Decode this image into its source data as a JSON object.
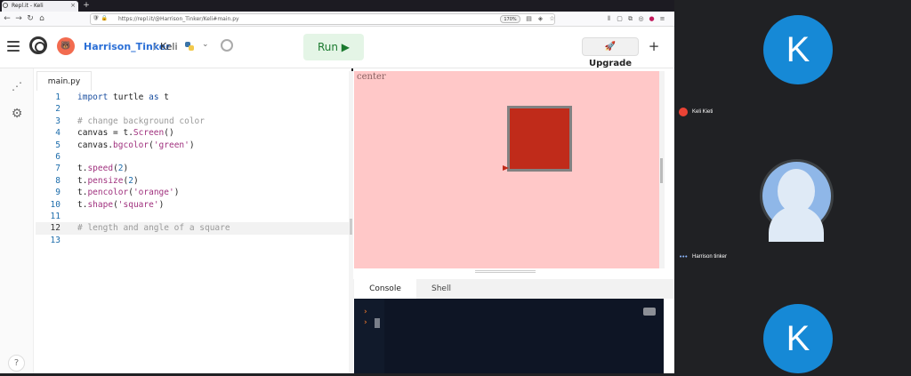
{
  "browser": {
    "tab_title": "Repl.it - Keli",
    "tab_close": "×",
    "new_tab": "+",
    "back": "←",
    "forward": "→",
    "reload": "↻",
    "home": "⌂",
    "url": "https://repl.it/@Harrison_Tinker/Keli#main.py",
    "zoom": "170%"
  },
  "header": {
    "avatar_initial": "🐻",
    "username": "Harrison_Tinker",
    "separator": "/",
    "repl_name": "Keli",
    "dropdown": "⌄",
    "run_label": "Run ▶",
    "upgrade_label": "🚀 Upgrade",
    "plus": "+"
  },
  "sidebar": {
    "share_icon": "⋰",
    "settings_icon": "⚙",
    "help": "?"
  },
  "editor": {
    "file_tab": "main.py",
    "lines": [
      {
        "n": "1",
        "text": "import turtle as t"
      },
      {
        "n": "2",
        "text": ""
      },
      {
        "n": "3",
        "text": "# change background color"
      },
      {
        "n": "4",
        "text": "canvas = t.Screen()"
      },
      {
        "n": "5",
        "text": "canvas.bgcolor('green')"
      },
      {
        "n": "6",
        "text": ""
      },
      {
        "n": "7",
        "text": "t.speed(2)"
      },
      {
        "n": "8",
        "text": "t.pensize(2)"
      },
      {
        "n": "9",
        "text": "t.pencolor('orange')"
      },
      {
        "n": "10",
        "text": "t.shape('square')"
      },
      {
        "n": "11",
        "text": ""
      },
      {
        "n": "12",
        "text": "# length and angle of a square"
      },
      {
        "n": "13",
        "text": ""
      }
    ],
    "active_line": "12"
  },
  "output": {
    "canvas_label": "center",
    "canvas_bg": "#ffc8c8",
    "square_color": "#c02b1a",
    "tabs": {
      "console": "Console",
      "shell": "Shell"
    },
    "prompt": "›",
    "prompt2": "›"
  },
  "call": {
    "participants": [
      {
        "initial": "K",
        "name": "Keli Kieti",
        "color": "#1689d6"
      },
      {
        "initial": "",
        "name": "Harrison tinker"
      },
      {
        "initial": "K",
        "color": "#1689d6"
      }
    ],
    "dots": "•••"
  }
}
